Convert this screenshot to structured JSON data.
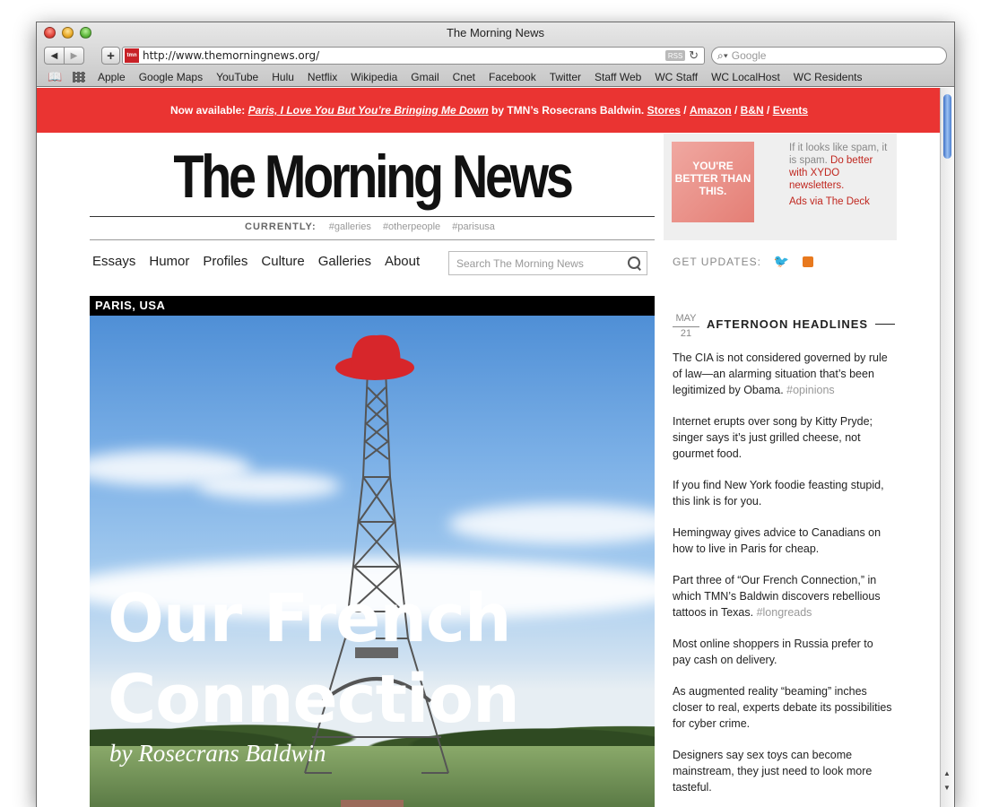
{
  "window": {
    "title": "The Morning News"
  },
  "toolbar": {
    "url": "http://www.themorningnews.org/",
    "favicon_text": "tmn",
    "rss_label": "RSS",
    "search_placeholder": "Google"
  },
  "bookmarks": [
    "Apple",
    "Google Maps",
    "YouTube",
    "Hulu",
    "Netflix",
    "Wikipedia",
    "Gmail",
    "Cnet",
    "Facebook",
    "Twitter",
    "Staff Web",
    "WC Staff",
    "WC LocalHost",
    "WC Residents"
  ],
  "banner": {
    "prefix": "Now available: ",
    "book": "Paris, I Love You But You’re Bringing Me Down",
    "middle": " by TMN’s Rosecrans Baldwin. ",
    "links": [
      "Stores",
      "Amazon",
      "B&N",
      "Events"
    ],
    "sep": " / "
  },
  "masthead": {
    "logo": "The Morning News",
    "currently_label": "CURRENTLY:",
    "tags": [
      "#galleries",
      "#otherpeople",
      "#parisusa"
    ]
  },
  "nav": [
    "Essays",
    "Humor",
    "Profiles",
    "Culture",
    "Galleries",
    "About"
  ],
  "site_search_placeholder": "Search The Morning News",
  "feature": {
    "kicker": "PARIS, USA",
    "headline_line1": "Our French",
    "headline_line2": "Connection",
    "byline": "by Rosecrans Baldwin"
  },
  "ad": {
    "image_text": "YOU'RE BETTER THAN THIS.",
    "text_gray": "If it looks like spam, it is spam. ",
    "text_red": "Do better with XYDO newsletters.",
    "link": "Ads via The Deck"
  },
  "updates_label": "GET UPDATES:",
  "headlines_section": {
    "month": "MAY",
    "day": "21",
    "title": "AFTERNOON HEADLINES",
    "items": [
      {
        "text": "The CIA is not considered governed by rule of law—an alarming situation that’s been legitimized by Obama. ",
        "tag": "#opinions"
      },
      {
        "text": "Internet erupts over song by Kitty Pryde; singer says it’s just grilled cheese, not gourmet food.",
        "tag": ""
      },
      {
        "text": "If you find New York foodie feasting stupid, this link is for you.",
        "tag": ""
      },
      {
        "text": "Hemingway gives advice to Canadians on how to live in Paris for cheap.",
        "tag": ""
      },
      {
        "text": "Part three of “Our French Connection,” in which TMN’s Baldwin discovers rebellious tattoos in Texas. ",
        "tag": "#longreads"
      },
      {
        "text": "Most online shoppers in Russia prefer to pay cash on delivery.",
        "tag": ""
      },
      {
        "text": "As augmented reality “beaming” inches closer to real, experts debate its possibilities for cyber crime.",
        "tag": ""
      },
      {
        "text": "Designers say sex toys can become mainstream, they just need to look more tasteful.",
        "tag": ""
      }
    ]
  },
  "colors": {
    "banner": "#ea3432",
    "accent_red": "#c0271f",
    "twitter": "#2ea8e3",
    "rss": "#e8791e"
  }
}
